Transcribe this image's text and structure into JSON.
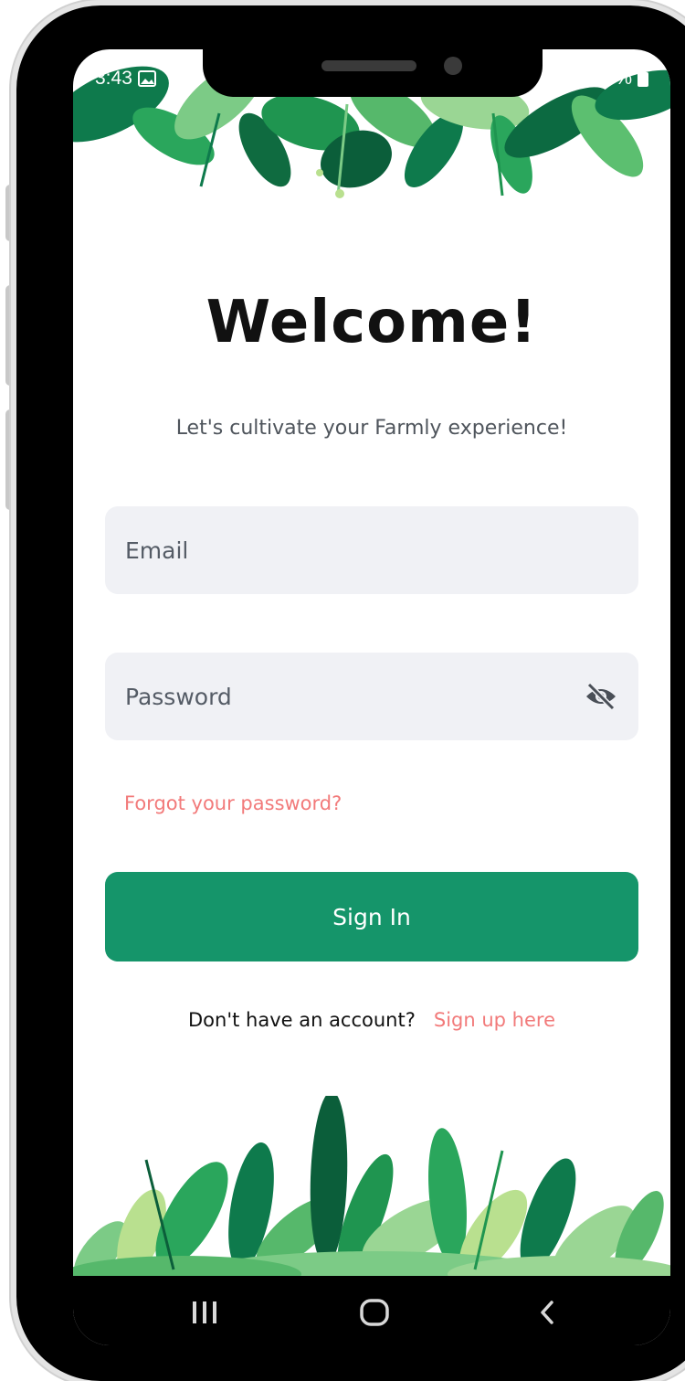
{
  "status_bar": {
    "time": "3:43",
    "battery": "83%"
  },
  "login": {
    "title": "Welcome!",
    "subtitle": "Let's cultivate your Farmly experience!",
    "email_placeholder": "Email",
    "password_placeholder": "Password",
    "forgot_password": "Forgot your password?",
    "sign_in_label": "Sign In",
    "no_account_text": "Don't have an account?",
    "sign_up_link": "Sign up here"
  },
  "icons": {
    "password_toggle": "eye-off-icon",
    "nav_recents": "recents-icon",
    "nav_home": "home-icon",
    "nav_back": "back-icon"
  },
  "colors": {
    "primary": "#15956a",
    "link": "#f27a7a",
    "field_bg": "#f0f1f5",
    "title": "#111111"
  }
}
